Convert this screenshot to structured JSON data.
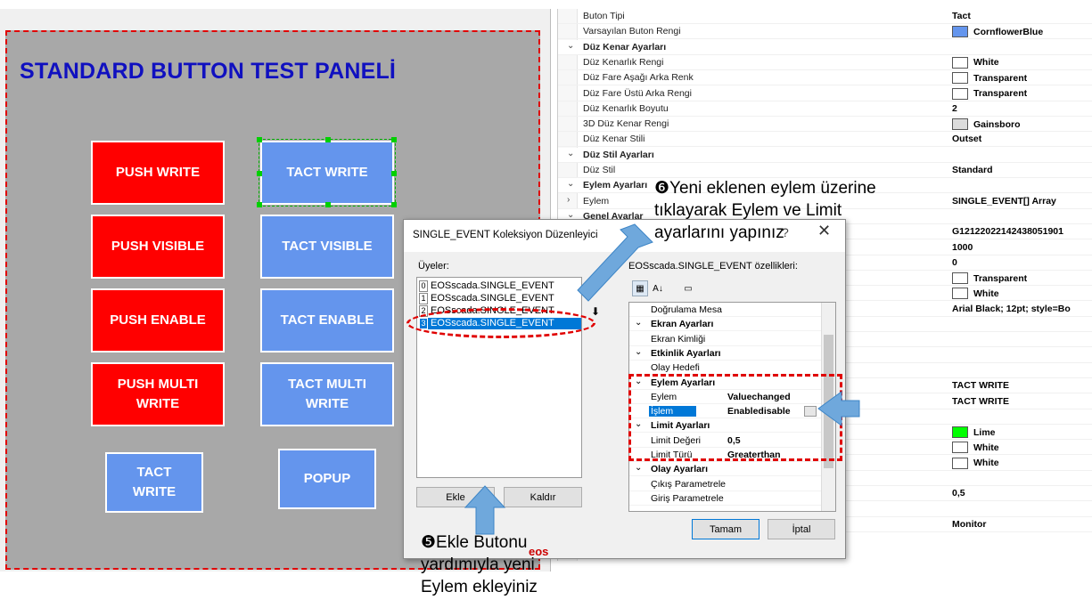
{
  "canvas": {
    "title": "STANDARD BUTTON TEST PANELİ",
    "buttons": [
      {
        "label": "PUSH WRITE",
        "kind": "red"
      },
      {
        "label": "TACT WRITE",
        "kind": "blue"
      },
      {
        "label": "PUSH VISIBLE",
        "kind": "red"
      },
      {
        "label": "TACT VISIBLE",
        "kind": "blue"
      },
      {
        "label": "PUSH ENABLE",
        "kind": "red"
      },
      {
        "label": "TACT ENABLE",
        "kind": "blue"
      },
      {
        "label": "PUSH MULTI\nWRITE",
        "kind": "red"
      },
      {
        "label": "TACT MULTI\nWRITE",
        "kind": "blue"
      },
      {
        "label": "TACT\nWRITE",
        "kind": "blue"
      },
      {
        "label": "POPUP",
        "kind": "blue"
      }
    ]
  },
  "propgrid": {
    "rows": [
      {
        "name": "Buton Tipi",
        "value": "Tact"
      },
      {
        "name": "Varsayılan Buton Rengi",
        "value": "CornflowerBlue",
        "swatch": "#6495ed"
      },
      {
        "name": "Düz Kenar Ayarları",
        "cat": true
      },
      {
        "name": "Düz Kenarlık Rengi",
        "value": "White",
        "swatch": "#ffffff"
      },
      {
        "name": "Düz Fare Aşağı Arka Renk",
        "value": "Transparent",
        "swatch": "#ffffff"
      },
      {
        "name": "Düz Fare Üstü Arka Rengi",
        "value": "Transparent",
        "swatch": "#ffffff"
      },
      {
        "name": "Düz Kenarlık Boyutu",
        "value": "2"
      },
      {
        "name": "3D Düz Kenar Rengi",
        "value": "Gainsboro",
        "swatch": "#dcdcdc"
      },
      {
        "name": "Düz Kenar Stili",
        "value": "Outset"
      },
      {
        "name": "Düz Stil Ayarları",
        "cat": true
      },
      {
        "name": "Düz Stil",
        "value": "Standard"
      },
      {
        "name": "Eylem Ayarları",
        "cat": true
      },
      {
        "name": "Eylem",
        "value": "SINGLE_EVENT[] Array",
        "expand": true
      },
      {
        "name": "Genel Ayarlar",
        "cat": true
      },
      {
        "name": "",
        "value": "G12122022142438051901"
      },
      {
        "name": "",
        "value": "1000"
      },
      {
        "name": "",
        "value": "0"
      },
      {
        "name": "",
        "value": "Transparent",
        "swatch": "#ffffff"
      },
      {
        "name": "",
        "value": "White",
        "swatch": "#ffffff"
      },
      {
        "name": "",
        "value": "Arial Black; 12pt; style=Bo"
      },
      {
        "name": "",
        "value": ""
      },
      {
        "name": "",
        "value": ""
      },
      {
        "name": "",
        "value": ""
      },
      {
        "name": "",
        "value": ""
      },
      {
        "name": "",
        "value": "TACT WRITE"
      },
      {
        "name": "",
        "value": "TACT WRITE"
      },
      {
        "name": "",
        "value": ""
      },
      {
        "name": "",
        "value": "Lime",
        "swatch": "#00ff00"
      },
      {
        "name": "",
        "value": "White",
        "swatch": "#ffffff"
      },
      {
        "name": "",
        "value": "White",
        "swatch": "#ffffff"
      },
      {
        "name": "",
        "value": ""
      },
      {
        "name": "",
        "value": "0,5"
      },
      {
        "name": "",
        "value": ""
      },
      {
        "name": "",
        "value": "Monitor"
      }
    ]
  },
  "dialog": {
    "title": "SINGLE_EVENT Koleksiyon Düzenleyici",
    "help": "?",
    "close": "✕",
    "members_label": "Üyeler:",
    "members": [
      {
        "index": "0",
        "label": "EOSscada.SINGLE_EVENT"
      },
      {
        "index": "1",
        "label": "EOSscada.SINGLE_EVENT"
      },
      {
        "index": "2",
        "label": "EOSscada.SINGLE_EVENT"
      },
      {
        "index": "3",
        "label": "EOSscada.SINGLE_EVENT",
        "selected": true
      }
    ],
    "props_label": "EOSscada.SINGLE_EVENT özellikleri:",
    "props": [
      {
        "name": "Doğrulama Mesa",
        "value": ""
      },
      {
        "name": "Ekran Ayarları",
        "cat": true
      },
      {
        "name": "Ekran Kimliği",
        "value": ""
      },
      {
        "name": "Etkinlik Ayarları",
        "cat": true
      },
      {
        "name": "Olay Hedefi",
        "value": ""
      },
      {
        "name": "Eylem Ayarları",
        "cat": true
      },
      {
        "name": "Eylem",
        "value": "Valuechanged"
      },
      {
        "name": "İşlem",
        "value": "Enabledisable",
        "selected": true
      },
      {
        "name": "Limit Ayarları",
        "cat": true
      },
      {
        "name": "Limit Değeri",
        "value": "0,5"
      },
      {
        "name": "Limit Türü",
        "value": "Greaterthan"
      },
      {
        "name": "Olay Ayarları",
        "cat": true
      },
      {
        "name": "Çıkış Parametrele",
        "value": ""
      },
      {
        "name": "Giriş Parametrele",
        "value": ""
      }
    ],
    "add_label": "Ekle",
    "remove_label": "Kaldır",
    "ok_label": "Tamam",
    "cancel_label": "İptal"
  },
  "annotations": {
    "step6": "❻Yeni eklenen eylem üzerine\ntıklayarak Eylem ve Limit\nayarlarını yapınız",
    "step5": "❺Ekle Butonu\nyardımıyla yeni\nEylem ekleyiniz",
    "logo": "eos"
  },
  "colors": {
    "red": "#ff0000",
    "blue": "#6495ed",
    "arrow": "#6fa8dc"
  }
}
